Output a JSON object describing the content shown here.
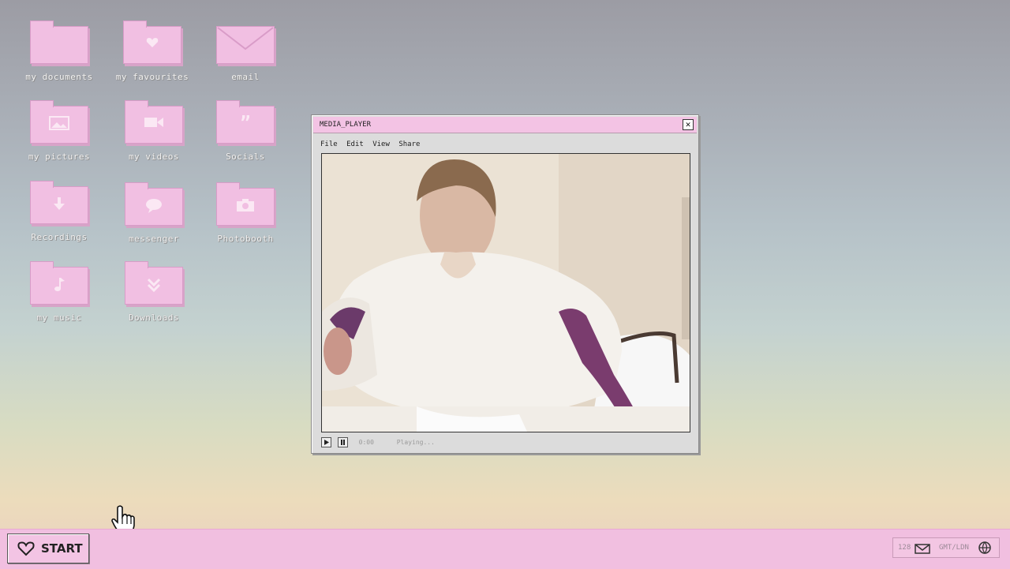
{
  "desktop": {
    "icons": [
      {
        "label": "my documents",
        "glyph": "folder-icon"
      },
      {
        "label": "my favourites",
        "glyph": "heart-icon"
      },
      {
        "label": "email",
        "glyph": "envelope-icon"
      },
      {
        "label": "my pictures",
        "glyph": "picture-icon"
      },
      {
        "label": "my videos",
        "glyph": "video-camera-icon"
      },
      {
        "label": "Socials",
        "glyph": "quote-icon"
      },
      {
        "label": "Recordings",
        "glyph": "download-arrow-icon"
      },
      {
        "label": "messenger",
        "glyph": "speech-bubble-icon"
      },
      {
        "label": "Photobooth",
        "glyph": "camera-icon"
      },
      {
        "label": "my music",
        "glyph": "music-note-icon"
      },
      {
        "label": "Downloads",
        "glyph": "double-chevron-down-icon"
      }
    ]
  },
  "media_player": {
    "title": "MEDIA_PLAYER",
    "close_glyph": "✕",
    "menu": [
      "File",
      "Edit",
      "View",
      "Share"
    ],
    "time": "0:00",
    "status": "Playing..."
  },
  "taskbar": {
    "start_label": "START",
    "tray_count": "128",
    "timezone": "GMT/LDN"
  },
  "colors": {
    "pink": "#f1bfe2",
    "pink_border": "#d99cc8",
    "titlebar": "#f3c3e4"
  }
}
